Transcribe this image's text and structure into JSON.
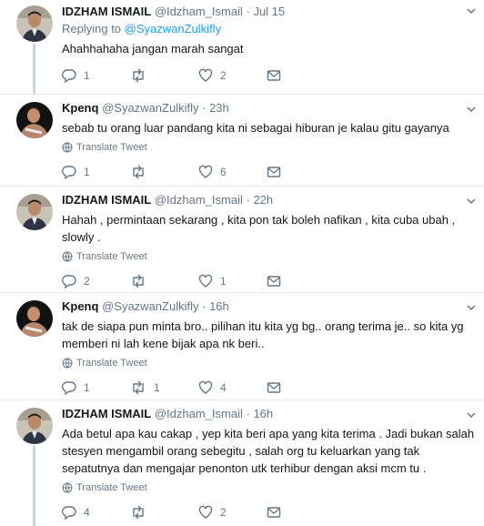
{
  "tweets": [
    {
      "name": "IDZHAM ISMAIL",
      "handle": "@Idzham_Ismail",
      "time": "Jul 15",
      "replying_prefix": "Replying to",
      "replying_to": "@SyazwanZulkifly",
      "text": "Ahahhahaha jangan marah sangat",
      "translate": "",
      "replies": "1",
      "retweets": "",
      "likes": "2",
      "avatar": "idzham"
    },
    {
      "name": "Kpenq",
      "handle": "@SyazwanZulkifly",
      "time": "23h",
      "text": "sebab tu orang luar pandang kita ni sebagai hiburan je kalau gitu gayanya",
      "translate": "Translate Tweet",
      "replies": "1",
      "retweets": "",
      "likes": "6",
      "avatar": "kpenq"
    },
    {
      "name": "IDZHAM ISMAIL",
      "handle": "@Idzham_Ismail",
      "time": "22h",
      "text": "Hahah , permintaan sekarang , kita pon tak boleh nafikan , kita cuba ubah , slowly .",
      "translate": "Translate Tweet",
      "replies": "2",
      "retweets": "",
      "likes": "1",
      "avatar": "idzham"
    },
    {
      "name": "Kpenq",
      "handle": "@SyazwanZulkifly",
      "time": "16h",
      "text": "tak de siapa pun minta bro.. pilihan itu kita yg bg.. orang terima je.. so kita yg memberi ni lah kene bijak apa nk beri..",
      "translate": "Translate Tweet",
      "replies": "1",
      "retweets": "1",
      "likes": "4",
      "avatar": "kpenq"
    },
    {
      "name": "IDZHAM ISMAIL",
      "handle": "@Idzham_Ismail",
      "time": "16h",
      "text": "Ada betul apa kau cakap , yep kita beri apa yang kita terima . Jadi bukan salah stesyen mengambil orang sebegitu , salah org tu keluarkan yang tak sepatutnya dan mengajar penonton utk terhibur dengan aksi mcm tu .",
      "translate": "Translate Tweet",
      "replies": "4",
      "retweets": "",
      "likes": "2",
      "avatar": "idzham"
    }
  ],
  "dot": "·",
  "colors": {
    "link": "#1da1f2",
    "muted": "#657786",
    "thread_line": "#ccd6dd"
  }
}
